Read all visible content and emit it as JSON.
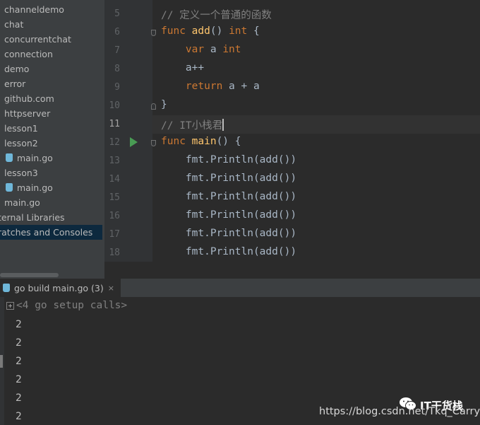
{
  "project_tree": {
    "items": [
      {
        "label": "channeldemo"
      },
      {
        "label": "chat"
      },
      {
        "label": "concurrentchat"
      },
      {
        "label": "connection"
      },
      {
        "label": "demo"
      },
      {
        "label": "error"
      },
      {
        "label": "github.com"
      },
      {
        "label": "httpserver"
      },
      {
        "label": "lesson1"
      },
      {
        "label": "lesson2"
      },
      {
        "label": "main.go"
      },
      {
        "label": "lesson3"
      },
      {
        "label": "main.go"
      },
      {
        "label": "main.go"
      },
      {
        "label": "ternal Libraries"
      },
      {
        "label": "ratches and Consoles"
      }
    ]
  },
  "editor": {
    "line_numbers": [
      "5",
      "6",
      "7",
      "8",
      "9",
      "10",
      "11",
      "12",
      "13",
      "14",
      "15",
      "16",
      "17",
      "18"
    ],
    "current_line": "11",
    "code": {
      "l5": "// 定义一个普通的函数",
      "l6_kw": "func",
      "l6_fn": "add",
      "l6_rest": "() ",
      "l6_type": "int",
      "l6_brace": " {",
      "l7_kw": "var",
      "l7_mid": " a ",
      "l7_type": "int",
      "l8": "a++",
      "l9_kw": "return",
      "l9_rest": " a + a",
      "l10": "}",
      "l11": "// IT小栈君",
      "l12_kw": "func",
      "l12_fn": "main",
      "l12_rest": "() {",
      "call": "fmt.Println(add())"
    }
  },
  "run_panel": {
    "tab_label": "go build main.go (3)",
    "close_glyph": "×",
    "setup_calls": "<4 go setup calls>",
    "output": [
      "2",
      "2",
      "2",
      "2",
      "2",
      "2"
    ]
  },
  "watermark": {
    "brand": "IT干货栈",
    "url": "https://blog.csdn.net/Tkq_Carry"
  },
  "colors": {
    "keyword": "#cc7832",
    "function": "#ffc66d",
    "comment": "#808080",
    "text": "#a9b7c6",
    "run_icon": "#499c54",
    "selection": "#0d293e"
  }
}
